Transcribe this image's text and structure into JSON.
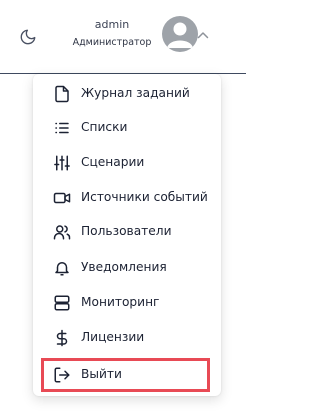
{
  "header": {
    "user_name": "admin",
    "user_role": "Администратор",
    "theme_icon": "moon-icon",
    "avatar_icon": "user-avatar-icon",
    "chevron_icon": "chevron-up-icon"
  },
  "menu": {
    "items": [
      {
        "label": "Журнал заданий",
        "icon": "file-icon"
      },
      {
        "label": "Списки",
        "icon": "list-icon"
      },
      {
        "label": "Сценарии",
        "icon": "sliders-icon"
      },
      {
        "label": "Источники событий",
        "icon": "video-camera-icon"
      },
      {
        "label": "Пользователи",
        "icon": "users-icon"
      },
      {
        "label": "Уведомления",
        "icon": "bell-icon"
      },
      {
        "label": "Мониторинг",
        "icon": "server-icon"
      },
      {
        "label": "Лицензии",
        "icon": "dollar-icon"
      },
      {
        "label": "Выйти",
        "icon": "logout-icon"
      }
    ]
  },
  "colors": {
    "text": "#1c2233",
    "header_border": "#3f4a60",
    "highlight": "#e84a55",
    "avatar": "#9ea3a9"
  }
}
